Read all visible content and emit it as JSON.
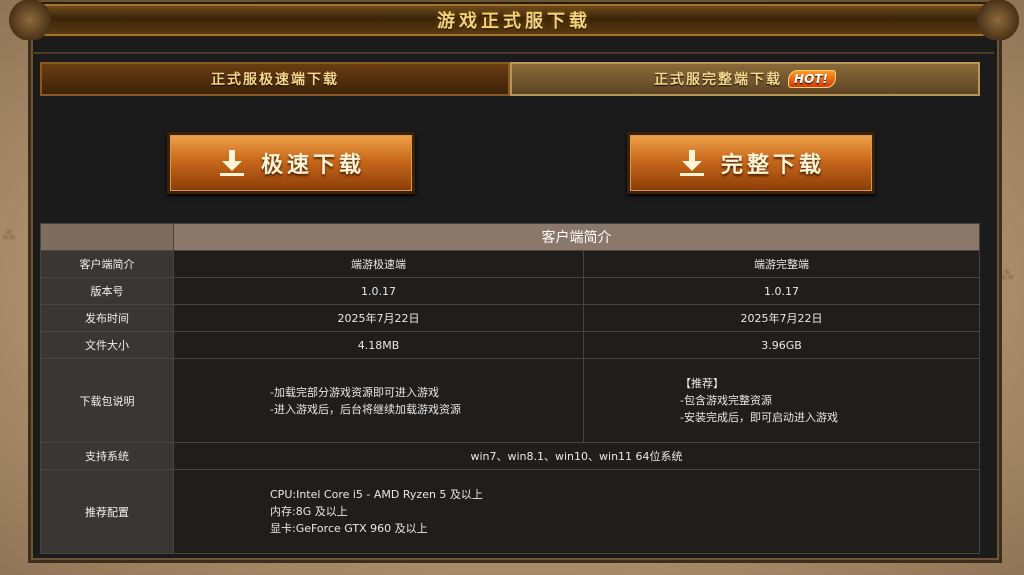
{
  "page_title": "游戏正式服下载",
  "tabs": [
    {
      "label": "正式服极速端下载"
    },
    {
      "label": "正式服完整端下载",
      "badge": "HOT!"
    }
  ],
  "buttons": {
    "fast": {
      "label": "极速下载",
      "icon": "download-arrow-icon"
    },
    "full": {
      "label": "完整下载",
      "icon": "download-arrow-icon"
    }
  },
  "table": {
    "section_title": "客户端简介",
    "rows": {
      "client": {
        "label": "客户端简介",
        "fast": "端游极速端",
        "full": "端游完整端"
      },
      "version": {
        "label": "版本号",
        "fast": "1.0.17",
        "full": "1.0.17"
      },
      "release": {
        "label": "发布时间",
        "fast": "2025年7月22日",
        "full": "2025年7月22日"
      },
      "size": {
        "label": "文件大小",
        "fast": "4.18MB",
        "full": "3.96GB"
      },
      "desc": {
        "label": "下载包说明",
        "fast": [
          "-加载完部分游戏资源即可进入游戏",
          "-进入游戏后，后台将继续加载游戏资源"
        ],
        "full": [
          "【推荐】",
          "-包含游戏完整资源",
          "-安装完成后，即可启动进入游戏"
        ]
      },
      "os": {
        "label": "支持系统",
        "value": "win7、win8.1、win10、win11 64位系统"
      },
      "spec": {
        "label": "推荐配置",
        "lines": [
          "CPU:Intel Core i5 - AMD Ryzen 5 及以上",
          "内存:8G 及以上",
          "显卡:GeForce GTX 960 及以上"
        ]
      }
    }
  },
  "colors": {
    "accent_gold": "#f4d27a",
    "button_orange": "#c9691c",
    "table_header": "#8a786a",
    "hot_badge": "#d23b08"
  }
}
